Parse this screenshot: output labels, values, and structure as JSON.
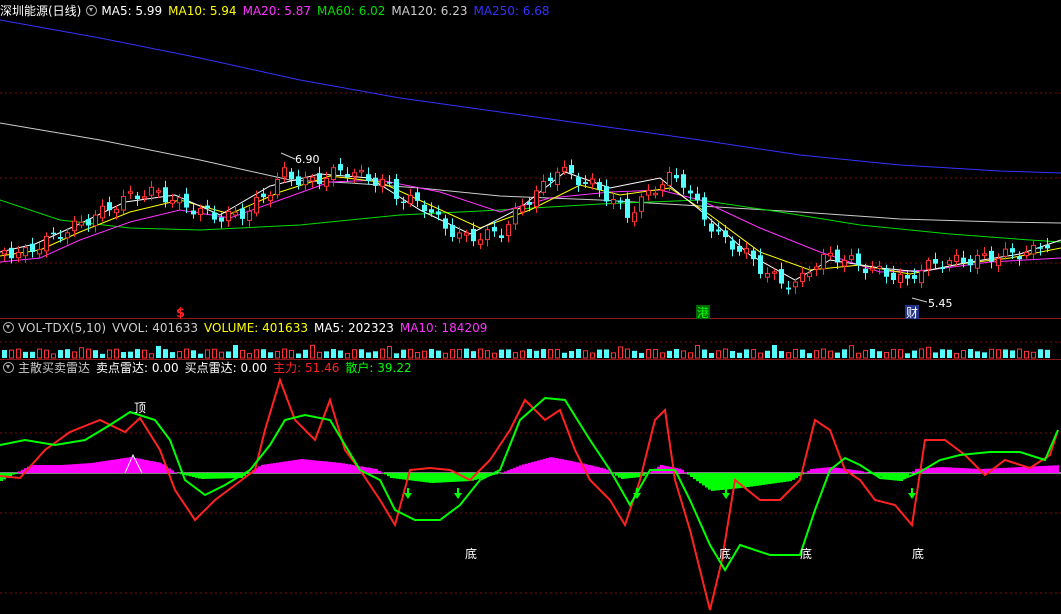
{
  "price_panel": {
    "title": "深圳能源(日线)",
    "indicators": [
      {
        "label": "MA5: 5.99",
        "color": "#ffffff"
      },
      {
        "label": "MA10: 5.94",
        "color": "#ffff00"
      },
      {
        "label": "MA20: 5.87",
        "color": "#ff33ff"
      },
      {
        "label": "MA60: 6.02",
        "color": "#00dd00"
      },
      {
        "label": "MA120: 6.23",
        "color": "#cccccc"
      },
      {
        "label": "MA250: 6.68",
        "color": "#3333ff"
      }
    ],
    "high_label": "6.90",
    "low_label": "5.45",
    "markers": [
      {
        "text": "$",
        "color": "#ff2222"
      },
      {
        "text": "港",
        "color": "#00ff00"
      },
      {
        "text": "财",
        "color": "#ffffff"
      }
    ]
  },
  "volume_panel": {
    "indicators": [
      {
        "label": "VOL-TDX(5,10)",
        "color": "#cccccc"
      },
      {
        "label": "VVOL: 401633",
        "color": "#cccccc"
      },
      {
        "label": "VOLUME: 401633",
        "color": "#ffff00"
      },
      {
        "label": "MA5: 202323",
        "color": "#ffffff"
      },
      {
        "label": "MA10: 184209",
        "color": "#ff33ff"
      }
    ]
  },
  "osc_panel": {
    "indicators": [
      {
        "label": "主散买卖雷达",
        "color": "#cccccc"
      },
      {
        "label": "卖点雷达: 0.00",
        "color": "#ffffff"
      },
      {
        "label": "买点雷达: 0.00",
        "color": "#ffffff"
      },
      {
        "label": "主力: 51.46",
        "color": "#ff2222"
      },
      {
        "label": "散户: 39.22",
        "color": "#00ff00"
      }
    ],
    "top_label": "顶",
    "bottom_labels": [
      "底",
      "底",
      "底",
      "底"
    ]
  },
  "colors": {
    "up": "#ff3333",
    "down": "#54ffff",
    "ma5": "#ffffff",
    "ma10": "#ffff00",
    "ma20": "#ff33ff",
    "ma60": "#00dd00",
    "ma120": "#cccccc",
    "ma250": "#3333ff",
    "main_force": "#ff2222",
    "retail": "#00ff00",
    "bar_pos": "#ff00ff",
    "bar_neg": "#00ff00"
  }
}
